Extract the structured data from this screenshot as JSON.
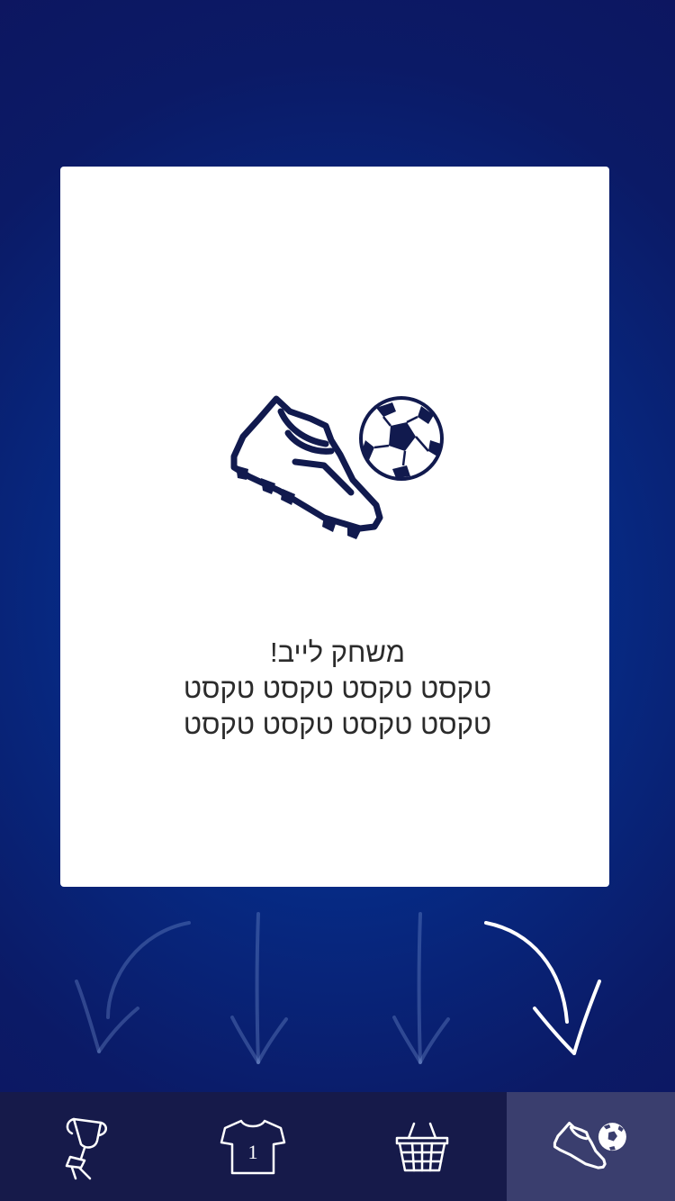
{
  "card": {
    "title": "משחק לייב!",
    "line1": "טקסט טקסט טקסט טקסט",
    "line2": "טקסט טקסט טקסט טקסט",
    "icon": "cleat-and-ball-icon"
  },
  "arrows": [
    {
      "name": "arrow-trophy",
      "state": "faded"
    },
    {
      "name": "arrow-shirt",
      "state": "faded"
    },
    {
      "name": "arrow-basket",
      "state": "faded"
    },
    {
      "name": "arrow-live-game",
      "state": "highlighted"
    }
  ],
  "tabbar": {
    "tabs": [
      {
        "icon": "trophy-icon",
        "active": false
      },
      {
        "icon": "jersey-icon",
        "label": "1",
        "active": false
      },
      {
        "icon": "basket-icon",
        "active": false
      },
      {
        "icon": "cleat-ball-icon",
        "active": true
      }
    ]
  },
  "colors": {
    "background": "#062a84",
    "card": "#ffffff",
    "icon_navy": "#111a4e",
    "tabbar": "#161a4a",
    "tab_active": "#3a3e6e"
  }
}
